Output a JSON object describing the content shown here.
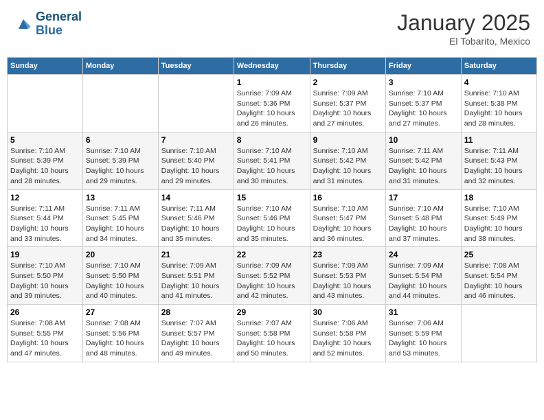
{
  "header": {
    "logo_line1": "General",
    "logo_line2": "Blue",
    "month_title": "January 2025",
    "location": "El Tobarito, Mexico"
  },
  "days_of_week": [
    "Sunday",
    "Monday",
    "Tuesday",
    "Wednesday",
    "Thursday",
    "Friday",
    "Saturday"
  ],
  "weeks": [
    [
      {
        "day": "",
        "info": ""
      },
      {
        "day": "",
        "info": ""
      },
      {
        "day": "",
        "info": ""
      },
      {
        "day": "1",
        "info": "Sunrise: 7:09 AM\nSunset: 5:36 PM\nDaylight: 10 hours\nand 26 minutes."
      },
      {
        "day": "2",
        "info": "Sunrise: 7:09 AM\nSunset: 5:37 PM\nDaylight: 10 hours\nand 27 minutes."
      },
      {
        "day": "3",
        "info": "Sunrise: 7:10 AM\nSunset: 5:37 PM\nDaylight: 10 hours\nand 27 minutes."
      },
      {
        "day": "4",
        "info": "Sunrise: 7:10 AM\nSunset: 5:38 PM\nDaylight: 10 hours\nand 28 minutes."
      }
    ],
    [
      {
        "day": "5",
        "info": "Sunrise: 7:10 AM\nSunset: 5:39 PM\nDaylight: 10 hours\nand 28 minutes."
      },
      {
        "day": "6",
        "info": "Sunrise: 7:10 AM\nSunset: 5:39 PM\nDaylight: 10 hours\nand 29 minutes."
      },
      {
        "day": "7",
        "info": "Sunrise: 7:10 AM\nSunset: 5:40 PM\nDaylight: 10 hours\nand 29 minutes."
      },
      {
        "day": "8",
        "info": "Sunrise: 7:10 AM\nSunset: 5:41 PM\nDaylight: 10 hours\nand 30 minutes."
      },
      {
        "day": "9",
        "info": "Sunrise: 7:10 AM\nSunset: 5:42 PM\nDaylight: 10 hours\nand 31 minutes."
      },
      {
        "day": "10",
        "info": "Sunrise: 7:11 AM\nSunset: 5:42 PM\nDaylight: 10 hours\nand 31 minutes."
      },
      {
        "day": "11",
        "info": "Sunrise: 7:11 AM\nSunset: 5:43 PM\nDaylight: 10 hours\nand 32 minutes."
      }
    ],
    [
      {
        "day": "12",
        "info": "Sunrise: 7:11 AM\nSunset: 5:44 PM\nDaylight: 10 hours\nand 33 minutes."
      },
      {
        "day": "13",
        "info": "Sunrise: 7:11 AM\nSunset: 5:45 PM\nDaylight: 10 hours\nand 34 minutes."
      },
      {
        "day": "14",
        "info": "Sunrise: 7:11 AM\nSunset: 5:46 PM\nDaylight: 10 hours\nand 35 minutes."
      },
      {
        "day": "15",
        "info": "Sunrise: 7:10 AM\nSunset: 5:46 PM\nDaylight: 10 hours\nand 35 minutes."
      },
      {
        "day": "16",
        "info": "Sunrise: 7:10 AM\nSunset: 5:47 PM\nDaylight: 10 hours\nand 36 minutes."
      },
      {
        "day": "17",
        "info": "Sunrise: 7:10 AM\nSunset: 5:48 PM\nDaylight: 10 hours\nand 37 minutes."
      },
      {
        "day": "18",
        "info": "Sunrise: 7:10 AM\nSunset: 5:49 PM\nDaylight: 10 hours\nand 38 minutes."
      }
    ],
    [
      {
        "day": "19",
        "info": "Sunrise: 7:10 AM\nSunset: 5:50 PM\nDaylight: 10 hours\nand 39 minutes."
      },
      {
        "day": "20",
        "info": "Sunrise: 7:10 AM\nSunset: 5:50 PM\nDaylight: 10 hours\nand 40 minutes."
      },
      {
        "day": "21",
        "info": "Sunrise: 7:09 AM\nSunset: 5:51 PM\nDaylight: 10 hours\nand 41 minutes."
      },
      {
        "day": "22",
        "info": "Sunrise: 7:09 AM\nSunset: 5:52 PM\nDaylight: 10 hours\nand 42 minutes."
      },
      {
        "day": "23",
        "info": "Sunrise: 7:09 AM\nSunset: 5:53 PM\nDaylight: 10 hours\nand 43 minutes."
      },
      {
        "day": "24",
        "info": "Sunrise: 7:09 AM\nSunset: 5:54 PM\nDaylight: 10 hours\nand 44 minutes."
      },
      {
        "day": "25",
        "info": "Sunrise: 7:08 AM\nSunset: 5:54 PM\nDaylight: 10 hours\nand 46 minutes."
      }
    ],
    [
      {
        "day": "26",
        "info": "Sunrise: 7:08 AM\nSunset: 5:55 PM\nDaylight: 10 hours\nand 47 minutes."
      },
      {
        "day": "27",
        "info": "Sunrise: 7:08 AM\nSunset: 5:56 PM\nDaylight: 10 hours\nand 48 minutes."
      },
      {
        "day": "28",
        "info": "Sunrise: 7:07 AM\nSunset: 5:57 PM\nDaylight: 10 hours\nand 49 minutes."
      },
      {
        "day": "29",
        "info": "Sunrise: 7:07 AM\nSunset: 5:58 PM\nDaylight: 10 hours\nand 50 minutes."
      },
      {
        "day": "30",
        "info": "Sunrise: 7:06 AM\nSunset: 5:58 PM\nDaylight: 10 hours\nand 52 minutes."
      },
      {
        "day": "31",
        "info": "Sunrise: 7:06 AM\nSunset: 5:59 PM\nDaylight: 10 hours\nand 53 minutes."
      },
      {
        "day": "",
        "info": ""
      }
    ]
  ]
}
